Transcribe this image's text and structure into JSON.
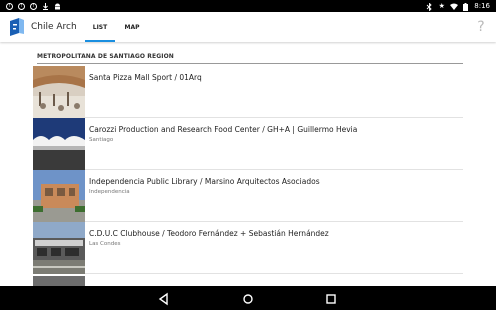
{
  "status_bar": {
    "left_icons": [
      "notification-icon",
      "notification-icon",
      "notification-icon",
      "download-icon",
      "android-icon"
    ],
    "right_icons": [
      "bluetooth-icon",
      "star-icon",
      "wifi-icon",
      "battery-icon"
    ],
    "time": "8:16"
  },
  "app_bar": {
    "title": "Chile Arch",
    "tabs": [
      {
        "label": "LIST",
        "selected": true
      },
      {
        "label": "MAP",
        "selected": false
      }
    ],
    "help_icon": "help-icon"
  },
  "accent_color": "#1a8fe0",
  "region": {
    "header": "METROPOLITANA DE SANTIAGO REGION",
    "items": [
      {
        "title": "Santa Pizza Mall Sport / 01Arq",
        "location": ""
      },
      {
        "title": "Carozzi Production and Research Food Center / GH+A | Guillermo Hevia",
        "location": "Santiago"
      },
      {
        "title": "Independencia Public Library / Marsino Arquitectos Asociados",
        "location": "Independencia"
      },
      {
        "title": "C.D.U.C Clubhouse / Teodoro Fernández + Sebastián Hernández",
        "location": "Las Condes"
      }
    ]
  },
  "nav_bar": {
    "buttons": [
      "back-icon",
      "home-icon",
      "recents-icon"
    ]
  }
}
